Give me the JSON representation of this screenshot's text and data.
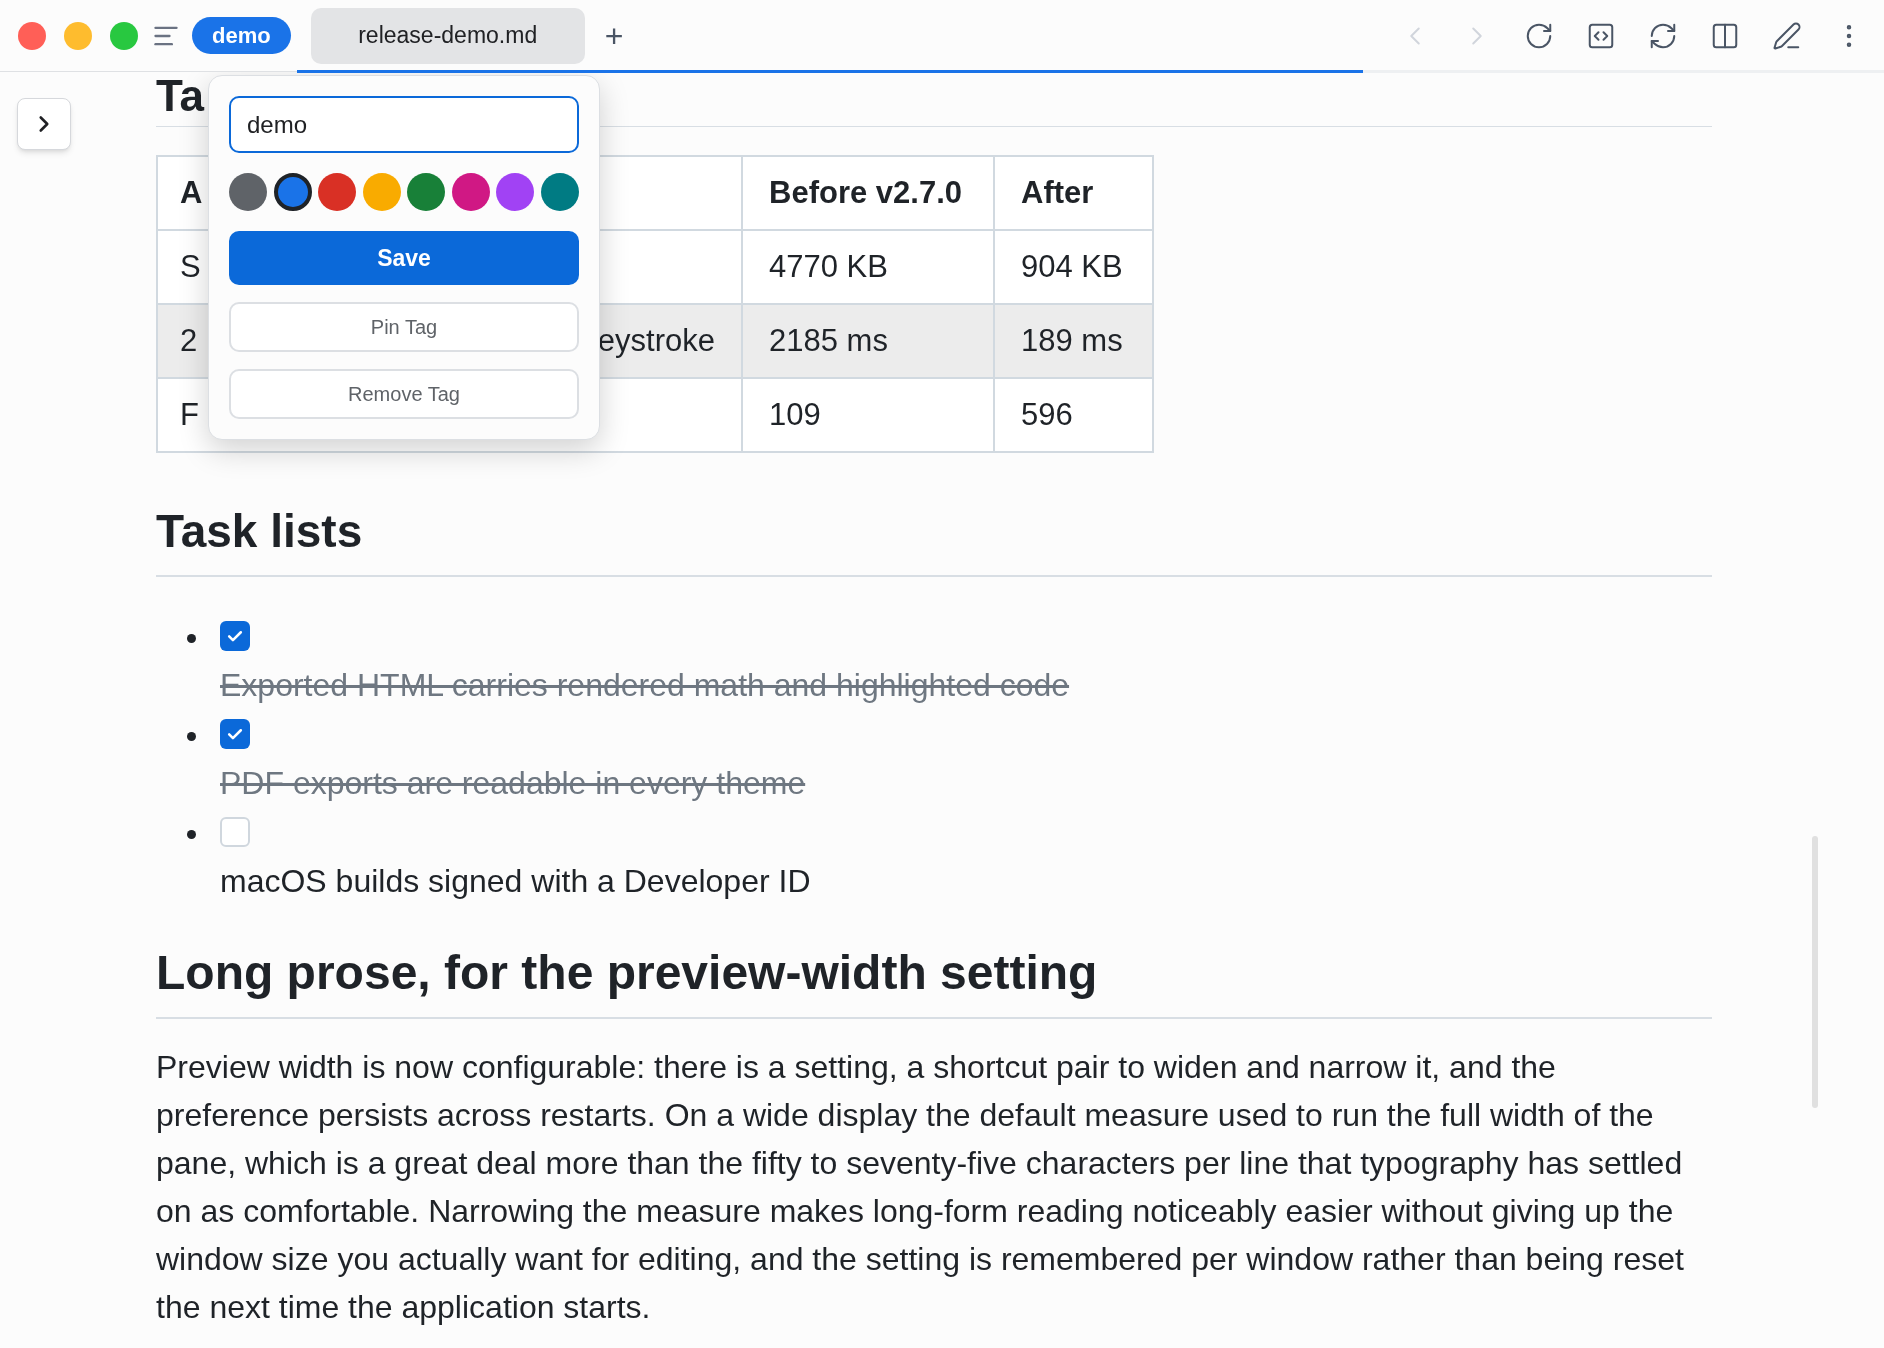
{
  "toolbar": {
    "tag": "demo",
    "tabs": [
      {
        "label": "release-demo.md",
        "selected": true
      }
    ],
    "new_tab": "+",
    "progress": {
      "level": 0.672
    }
  },
  "document": {
    "heading_1": "Ta",
    "table": {
      "columns": [
        {
          "label": "A"
        },
        {
          "label": "Before v2.7.0"
        },
        {
          "label": "After"
        }
      ],
      "rows": [
        {
          "cells": [
            [
              "S"
            ],
            [
              "4770 KB"
            ],
            [
              "904 KB"
            ]
          ],
          "highlighted": false
        },
        {
          "cells": [
            [
              "2",
              "eystroke"
            ],
            [
              "2185 ms"
            ],
            [
              "189 ms"
            ]
          ],
          "highlighted": true
        },
        {
          "cells": [
            [
              "F"
            ],
            [
              "109"
            ],
            [
              "596"
            ]
          ],
          "highlighted": false
        }
      ]
    },
    "heading_2": "Task lists",
    "tasks": [
      {
        "label": "Exported HTML carries rendered math and highlighted code",
        "checked": true
      },
      {
        "label": "PDF exports are readable in every theme",
        "checked": true
      },
      {
        "label": "macOS builds signed with a Developer ID",
        "checked": false
      }
    ],
    "heading_3": "Long prose, for the preview-width setting",
    "paragraph": "Preview width is now configurable: there is a setting, a shortcut pair to widen and narrow it, and the preference persists across restarts. On a wide display the default measure used to run the full width of the pane, which is a great deal more than the fifty to seventy-five characters per line that typography has settled on as comfortable. Narrowing the measure makes long-form reading noticeably easier without giving up the window size you actually want for editing, and the setting is remembered per window rather than being reset the next time the application starts."
  },
  "popover": {
    "value": "demo",
    "swatches": [
      {
        "color": "#5f6368",
        "selected": false
      },
      {
        "color": "#1a73e8",
        "selected": true
      },
      {
        "color": "#d93025",
        "selected": false
      },
      {
        "color": "#f9ab00",
        "selected": false
      },
      {
        "color": "#188038",
        "selected": false
      },
      {
        "color": "#d01884",
        "selected": false
      },
      {
        "color": "#a142f4",
        "selected": false
      },
      {
        "color": "#007b83",
        "selected": false
      }
    ],
    "buttons": [
      {
        "label": "Save",
        "kind": "primary"
      },
      {
        "label": "Pin Tag",
        "kind": "secondary"
      },
      {
        "label": "Remove Tag",
        "kind": "secondary"
      }
    ]
  }
}
